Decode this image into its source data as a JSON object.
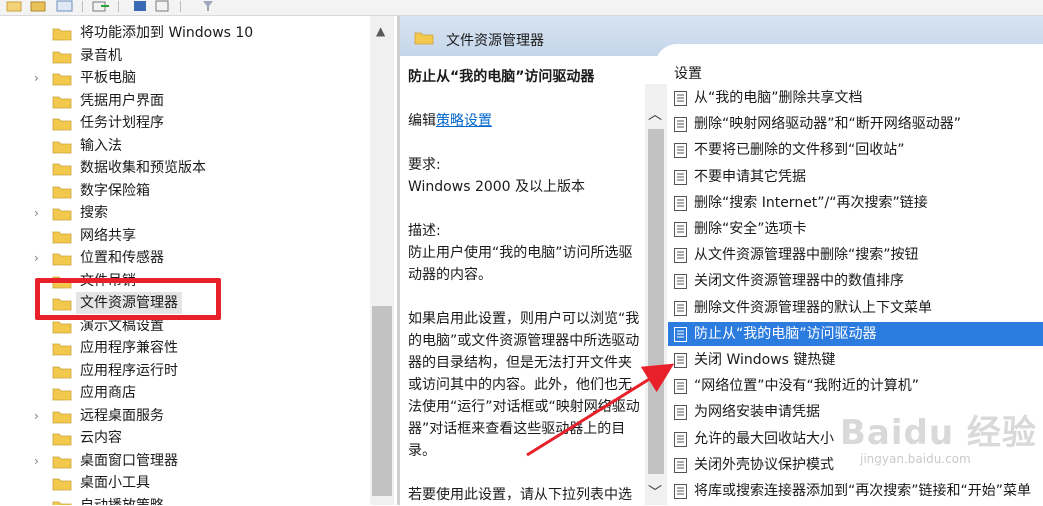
{
  "tree": {
    "items": [
      {
        "label": "将功能添加到 Windows 10",
        "chev": ""
      },
      {
        "label": "录音机",
        "chev": ""
      },
      {
        "label": "平板电脑",
        "chev": "›"
      },
      {
        "label": "凭据用户界面",
        "chev": ""
      },
      {
        "label": "任务计划程序",
        "chev": ""
      },
      {
        "label": "输入法",
        "chev": ""
      },
      {
        "label": "数据收集和预览版本",
        "chev": ""
      },
      {
        "label": "数字保险箱",
        "chev": ""
      },
      {
        "label": "搜索",
        "chev": "›"
      },
      {
        "label": "网络共享",
        "chev": ""
      },
      {
        "label": "位置和传感器",
        "chev": "›"
      },
      {
        "label": "文件吊销",
        "chev": ""
      },
      {
        "label": "文件资源管理器",
        "chev": ""
      },
      {
        "label": "演示文稿设置",
        "chev": ""
      },
      {
        "label": "应用程序兼容性",
        "chev": ""
      },
      {
        "label": "应用程序运行时",
        "chev": ""
      },
      {
        "label": "应用商店",
        "chev": ""
      },
      {
        "label": "远程桌面服务",
        "chev": "›"
      },
      {
        "label": "云内容",
        "chev": ""
      },
      {
        "label": "桌面窗口管理器",
        "chev": "›"
      },
      {
        "label": "桌面小工具",
        "chev": ""
      },
      {
        "label": "自动播放策略",
        "chev": ""
      }
    ]
  },
  "right": {
    "header_title": "文件资源管理器",
    "desc": {
      "title": "防止从“我的电脑”访问驱动器",
      "edit_prefix": "编辑",
      "edit_link": "策略设置",
      "requirement_label": "要求:",
      "requirement_value": "Windows 2000 及以上版本",
      "description_label": "描述:",
      "description_text": "防止用户使用“我的电脑”访问所选驱动器的内容。",
      "para2": "如果启用此设置，则用户可以浏览“我的电脑”或文件资源管理器中所选驱动器的目录结构，但是无法打开文件夹或访问其中的内容。此外，他们也无法使用“运行”对话框或“映射网络驱动器”对话框来查看这些驱动器上的目录。",
      "para3": "若要使用此设置，请从下拉列表中选择一个驱动器或多个驱动器的组"
    },
    "settings_title": "设置",
    "settings": [
      "从“我的电脑”删除共享文档",
      "删除“映射网络驱动器”和“断开网络驱动器”",
      "不要将已删除的文件移到“回收站”",
      "不要申请其它凭据",
      "删除“搜索 Internet”/“再次搜索”链接",
      "删除“安全”选项卡",
      "从文件资源管理器中删除“搜索”按钮",
      "关闭文件资源管理器中的数值排序",
      "删除文件资源管理器的默认上下文菜单",
      "防止从“我的电脑”访问驱动器",
      "关闭 Windows 键热键",
      "“网络位置”中没有“我附近的计算机”",
      "为网络安装申请凭据",
      "允许的最大回收站大小",
      "关闭外壳协议保护模式",
      "将库或搜索连接器添加到“再次搜索”链接和“开始”菜单"
    ]
  },
  "watermark": {
    "brand": "Baidu 经验",
    "sub": "jingyan.baidu.com"
  },
  "colors": {
    "selection": "#2c7ce0",
    "highlight_box": "#e8202a",
    "arrow": "#e8202a"
  }
}
